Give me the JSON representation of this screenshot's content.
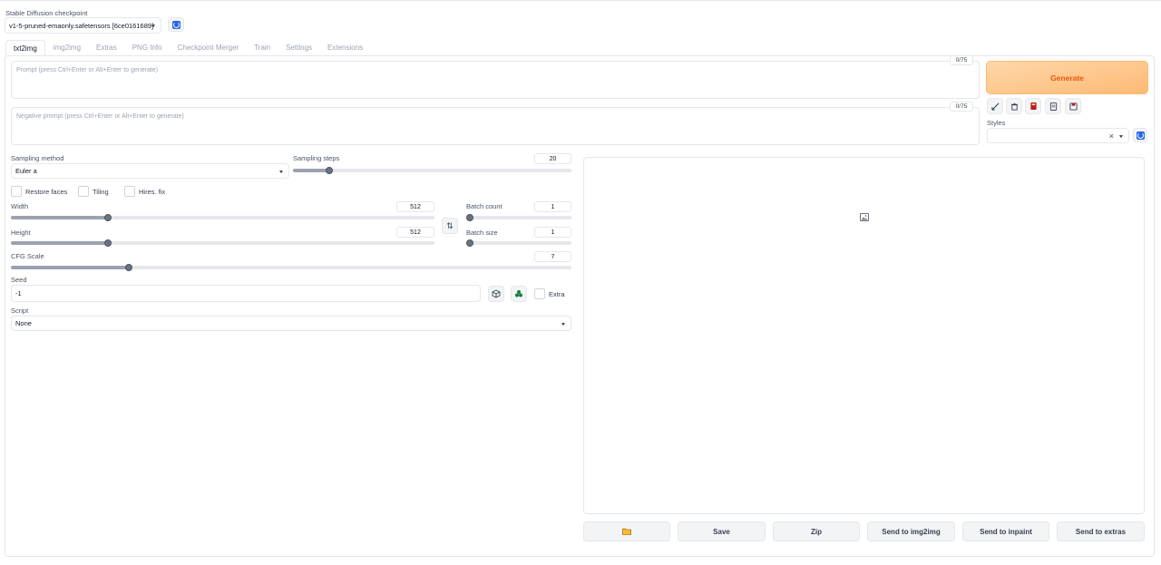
{
  "checkpoint": {
    "label": "Stable Diffusion checkpoint",
    "value": "v1-5-pruned-emaonly.safetensors [6ce0161689]"
  },
  "tabs": [
    {
      "label": "txt2img"
    },
    {
      "label": "img2img"
    },
    {
      "label": "Extras"
    },
    {
      "label": "PNG Info"
    },
    {
      "label": "Checkpoint Merger"
    },
    {
      "label": "Train"
    },
    {
      "label": "Settings"
    },
    {
      "label": "Extensions"
    }
  ],
  "prompt": {
    "placeholder": "Prompt (press Ctrl+Enter or Alt+Enter to generate)",
    "counter": "0/75"
  },
  "negative_prompt": {
    "placeholder": "Negative prompt (press Ctrl+Enter or Alt+Enter to generate)",
    "counter": "0/75"
  },
  "generate_label": "Generate",
  "tools": [
    "check-icon",
    "trash-icon",
    "book-icon",
    "clipboard-icon",
    "save-icon"
  ],
  "styles": {
    "label": "Styles",
    "clear": "×"
  },
  "sampling_method": {
    "label": "Sampling method",
    "value": "Euler a"
  },
  "sampling_steps": {
    "label": "Sampling steps",
    "value": "20",
    "fraction": 0.13
  },
  "restore_faces": {
    "label": "Restore faces",
    "checked": false
  },
  "tiling": {
    "label": "Tiling",
    "checked": false
  },
  "hires_fix": {
    "label": "Hires. fix",
    "checked": false
  },
  "width": {
    "label": "Width",
    "value": "512",
    "fraction": 0.23
  },
  "height": {
    "label": "Height",
    "value": "512",
    "fraction": 0.23
  },
  "batch_count": {
    "label": "Batch count",
    "value": "1",
    "fraction": 0.0
  },
  "batch_size": {
    "label": "Batch size",
    "value": "1",
    "fraction": 0.0
  },
  "swap_label": "⇅",
  "cfg_scale": {
    "label": "CFG Scale",
    "value": "7",
    "fraction": 0.21
  },
  "seed": {
    "label": "Seed",
    "value": "-1",
    "extra_label": "Extra"
  },
  "script": {
    "label": "Script",
    "value": "None"
  },
  "actions": [
    {
      "label": ""
    },
    {
      "label": "Save"
    },
    {
      "label": "Zip"
    },
    {
      "label": "Send to img2img"
    },
    {
      "label": "Send to inpaint"
    },
    {
      "label": "Send to extras"
    }
  ],
  "colors": {
    "accent": "#f97316",
    "generate_bg": "#fdba74",
    "refresh": "#2563eb"
  }
}
